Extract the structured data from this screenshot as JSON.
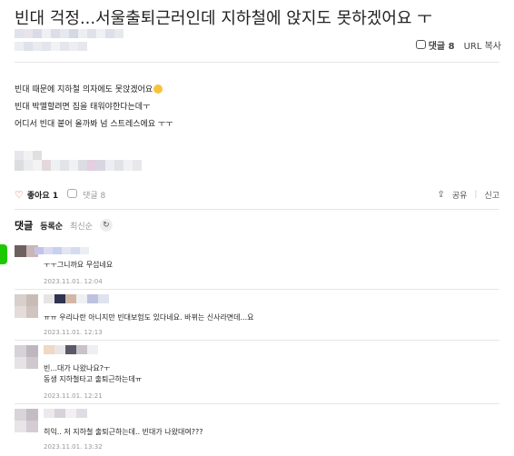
{
  "post": {
    "title": "빈대 걱정...서울출퇴근러인데 지하철에 앉지도 못하겠어요 ㅜ",
    "comment_count_label": "댓글 8",
    "url_copy_label": "URL 복사",
    "body_lines": [
      "빈대 때문에 지하철 의자에도 못앉겠어요",
      "빈대 박멸할려면 집을 태워야한다는데ㅜ",
      "어디서 빈대 붙어 올까봐 넘 스트레스에요 ㅜㅜ"
    ],
    "emoji_icon": "grinning-sweat-emoji"
  },
  "actions": {
    "like_label": "좋아요 1",
    "comment_label": "댓글 8",
    "share_label": "공유",
    "report_label": "신고",
    "separator": "|"
  },
  "comments_section": {
    "heading": "댓글",
    "sort_registered": "등록순",
    "sort_latest": "최신순",
    "refresh_icon": "refresh-icon",
    "refresh_glyph": "↻"
  },
  "comments": [
    {
      "lines": [
        "ㅜㅜ그니까요 무섭네요"
      ],
      "date": "2023.11.01. 12:04"
    },
    {
      "lines": [
        "ㅠㅠ 우리나란 아니지만 빈대보험도 있다네요. 바뀌는 신사라면데...요"
      ],
      "date": "2023.11.01. 12:13"
    },
    {
      "lines": [
        "빈...대가 나왔나요?ㅜ",
        "동생 지하철타고 출퇴근하는데ㅠ"
      ],
      "date": "2023.11.01. 12:21"
    },
    {
      "lines": [
        "히익.. 저 지하철 출퇴근하는데.. 빈대가 나왔대여???"
      ],
      "date": "2023.11.01. 13:32"
    }
  ],
  "colors": {
    "like": "#e34b4b",
    "side_tab": "#1ec800",
    "muted": "#999999"
  }
}
